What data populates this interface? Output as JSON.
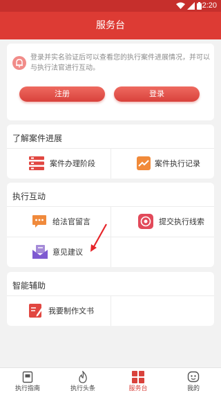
{
  "status_bar": {
    "time": "2:20"
  },
  "title": "服务台",
  "notice": {
    "message": "登录并实名验证后可以查看您的执行案件进展情况，并可以与执行法官进行互动。",
    "register_label": "注册",
    "login_label": "登录"
  },
  "sections": [
    {
      "title": "了解案件进展",
      "items": [
        "案件办理阶段",
        "案件执行记录"
      ]
    },
    {
      "title": "执行互动",
      "items": [
        "给法官留言",
        "提交执行线索",
        "意见建议"
      ]
    },
    {
      "title": "智能辅助",
      "items": [
        "我要制作文书"
      ]
    }
  ],
  "tabs": [
    {
      "label": "执行指南"
    },
    {
      "label": "执行头条"
    },
    {
      "label": "服务台"
    },
    {
      "label": "我的"
    }
  ],
  "colors": {
    "brand": "#dd3b34",
    "active_tab": "#d9423c"
  }
}
